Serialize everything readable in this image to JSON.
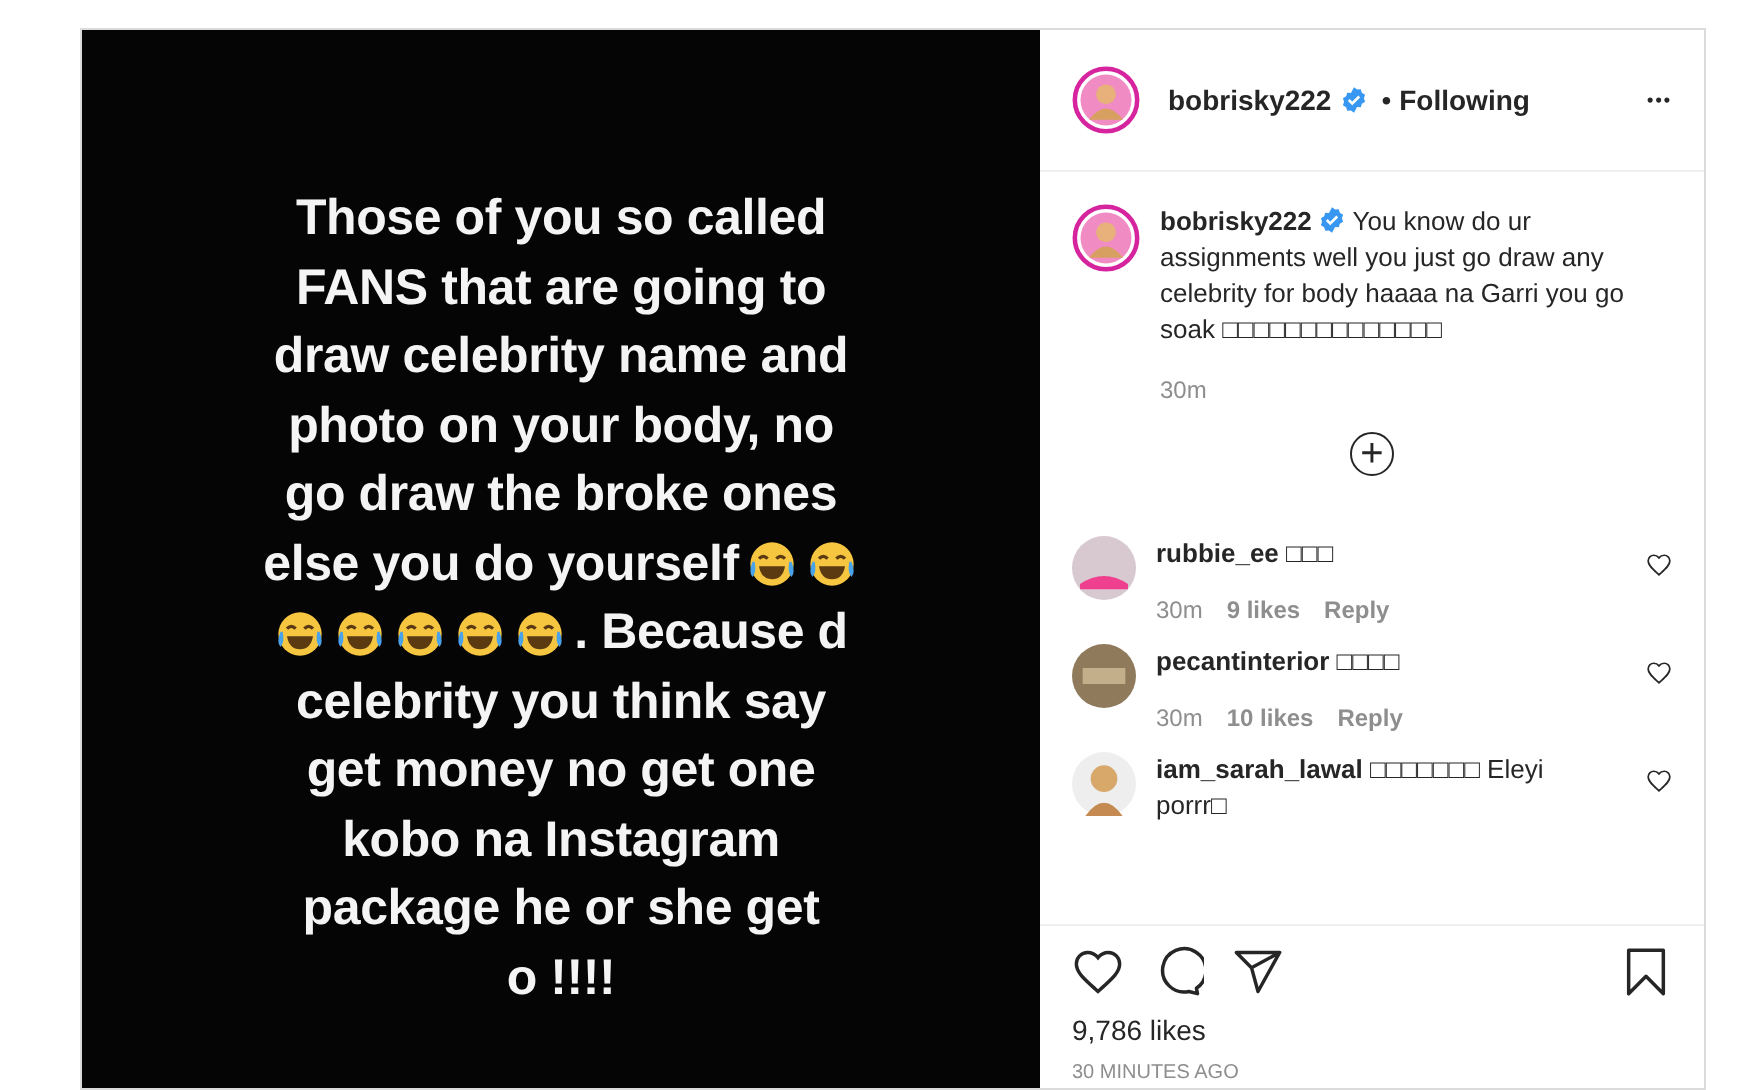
{
  "post_image": {
    "lines": [
      [
        {
          "kind": "text",
          "text": "Those of you so called"
        }
      ],
      [
        {
          "kind": "text",
          "text": "FANS that are going to"
        }
      ],
      [
        {
          "kind": "text",
          "text": "draw celebrity name and"
        }
      ],
      [
        {
          "kind": "text",
          "text": "photo on your body, no"
        }
      ],
      [
        {
          "kind": "text",
          "text": "go draw the broke ones"
        }
      ],
      [
        {
          "kind": "text",
          "text": "else you do yourself"
        },
        {
          "kind": "emoji"
        },
        {
          "kind": "emoji"
        }
      ],
      [
        {
          "kind": "emoji"
        },
        {
          "kind": "emoji"
        },
        {
          "kind": "emoji"
        },
        {
          "kind": "emoji"
        },
        {
          "kind": "emoji"
        },
        {
          "kind": "text",
          "text": ". Because d"
        }
      ],
      [
        {
          "kind": "text",
          "text": "celebrity you think say"
        }
      ],
      [
        {
          "kind": "text",
          "text": "get money no get one"
        }
      ],
      [
        {
          "kind": "text",
          "text": "kobo na Instagram"
        }
      ],
      [
        {
          "kind": "text",
          "text": "package he or she get"
        }
      ],
      [
        {
          "kind": "text",
          "text": "o !!!!"
        }
      ]
    ]
  },
  "header": {
    "username": "bobrisky222",
    "verified": true,
    "separator": "•",
    "follow": "Following",
    "more": "•••"
  },
  "caption": {
    "username": "bobrisky222",
    "verified": true,
    "text": "You know do ur assignments well you just go draw any celebrity for body haaaa na Garri you go soak □□□□□□□□□□□□□□",
    "time": "30m"
  },
  "load_more": "+",
  "comments": [
    {
      "username": "rubbie_ee",
      "text": "□□□",
      "time": "30m",
      "likes": "9 likes",
      "reply": "Reply",
      "liked": false
    },
    {
      "username": "pecantinterior",
      "text": "□□□□",
      "time": "30m",
      "likes": "10 likes",
      "reply": "Reply",
      "liked": false
    },
    {
      "username": "iam_sarah_lawal",
      "text": "□□□□□□□ Eleyi porrr□",
      "liked": false
    }
  ],
  "footer": {
    "liked": false,
    "saved": false,
    "likes": "9,786 likes",
    "time": "30 MINUTES AGO"
  }
}
